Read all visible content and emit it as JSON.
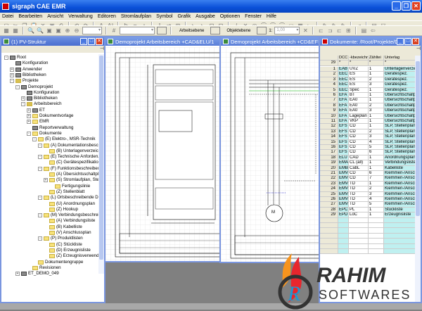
{
  "app": {
    "title": "sigraph CAE EMR"
  },
  "menu": [
    "Datei",
    "Bearbeiten",
    "Ansicht",
    "Verwaltung",
    "Editoren",
    "Stromlaufplan",
    "Symbol",
    "Grafik",
    "Ausgabe",
    "Optionen",
    "Fenster",
    "Hilfe"
  ],
  "toolbar": {
    "arbeitsebene": "Arbeitsebene",
    "objektebene": "Objektebene",
    "scale_prefix": "1:",
    "scale_value": "1,00"
  },
  "tree_panel": {
    "title": "(1) PV-Struktur",
    "nodes": [
      {
        "d": 0,
        "e": "-",
        "i": "t",
        "t": "Root"
      },
      {
        "d": 1,
        "e": "",
        "i": "t",
        "t": "Konfiguration"
      },
      {
        "d": 1,
        "e": "+",
        "i": "t",
        "t": "Anwender"
      },
      {
        "d": 1,
        "e": "+",
        "i": "t",
        "t": "Bibliotheken"
      },
      {
        "d": 1,
        "e": "-",
        "i": "g",
        "t": "Projekte"
      },
      {
        "d": 2,
        "e": "-",
        "i": "t",
        "t": "Demoprojekt"
      },
      {
        "d": 3,
        "e": "",
        "i": "t",
        "t": "Konfiguration"
      },
      {
        "d": 3,
        "e": "+",
        "i": "t",
        "t": "Bibliotheken"
      },
      {
        "d": 3,
        "e": "-",
        "i": "g",
        "t": "Arbeitsbereich"
      },
      {
        "d": 4,
        "e": "+",
        "i": "t",
        "t": "ET"
      },
      {
        "d": 4,
        "e": "+",
        "i": "f",
        "t": "Dokumentvorlage"
      },
      {
        "d": 4,
        "e": "+",
        "i": "f",
        "t": "EMR"
      },
      {
        "d": 4,
        "e": "",
        "i": "t",
        "t": "Reportverwaltung"
      },
      {
        "d": 4,
        "e": "-",
        "i": "f",
        "t": "Dokumente"
      },
      {
        "d": 5,
        "e": "-",
        "i": "f",
        "t": "(E) Elektro-, MSR-Technik"
      },
      {
        "d": 6,
        "e": "-",
        "i": "f",
        "t": "(A) Dokumentationsbeschreibende"
      },
      {
        "d": 7,
        "e": "",
        "i": "f",
        "t": "(B) Unterlagenverzeichnis"
      },
      {
        "d": 6,
        "e": "-",
        "i": "f",
        "t": "(E) Technische Anforderungen und"
      },
      {
        "d": 7,
        "e": "",
        "i": "f",
        "t": "(C) Gerätespezifikation"
      },
      {
        "d": 6,
        "e": "-",
        "i": "f",
        "t": "(F) Funktionsbeschreibende Dokun"
      },
      {
        "d": 7,
        "e": "",
        "i": "f",
        "t": "(A) Übersichtsschaltplan"
      },
      {
        "d": 7,
        "e": "+",
        "i": "f",
        "t": "(S) Stromlaufplan, Stellenplan"
      },
      {
        "d": 8,
        "e": "",
        "i": "f",
        "t": "Fertigungslinie"
      },
      {
        "d": 7,
        "e": "",
        "i": "f",
        "t": "(Z) Stellenblatt"
      },
      {
        "d": 6,
        "e": "-",
        "i": "f",
        "t": "(L) Ortsbeschreibende Dokumente"
      },
      {
        "d": 7,
        "e": "",
        "i": "f",
        "t": "(U) Anordnungsplan"
      },
      {
        "d": 7,
        "e": "",
        "i": "f",
        "t": "(Z) Hookup"
      },
      {
        "d": 6,
        "e": "-",
        "i": "f",
        "t": "(M) Verbindungsbeschreibende Do"
      },
      {
        "d": 7,
        "e": "",
        "i": "f",
        "t": "(A) Verbindungsliste"
      },
      {
        "d": 7,
        "e": "",
        "i": "f",
        "t": "(B) Kabelliste"
      },
      {
        "d": 7,
        "e": "",
        "i": "f",
        "t": "(V) Anschlussplan"
      },
      {
        "d": 6,
        "e": "-",
        "i": "f",
        "t": "(P) Produktlisten"
      },
      {
        "d": 7,
        "e": "",
        "i": "f",
        "t": "(C) Stückliste"
      },
      {
        "d": 7,
        "e": "",
        "i": "f",
        "t": "(D) Erzeugnisliste"
      },
      {
        "d": 7,
        "e": "",
        "i": "f",
        "t": "(Z) Erzeugnisverwendungsplan"
      },
      {
        "d": 5,
        "e": "",
        "i": "f",
        "t": "Dokumentengruppe"
      },
      {
        "d": 4,
        "e": "",
        "i": "f",
        "t": "Revisionen"
      },
      {
        "d": 2,
        "e": "+",
        "i": "t",
        "t": "ET_DEMO_049"
      }
    ]
  },
  "drawing1": {
    "title": "Demoprojekt Arbeitsbereich +CAD&ELU/1"
  },
  "drawing2": {
    "title": "Demoprojekt Arbeitsbereich +CD&EFS/2"
  },
  "doc_panel": {
    "title": "Dokumente: /Root/Projekte/De...",
    "headers": [
      "",
      "DCC",
      "-kbezeichn",
      "Zähltei",
      "Unterlag"
    ],
    "count": "29",
    "filter": [
      "",
      "*",
      "*",
      "*",
      "*"
    ],
    "rows": [
      [
        "1",
        "EAB",
        "UVZ",
        "1",
        "Unterlagenverzeic"
      ],
      [
        "2",
        "EEC",
        "ES",
        "1",
        "Gerätespez."
      ],
      [
        "3",
        "EEC",
        "ES",
        "2",
        "Gerätespez."
      ],
      [
        "4",
        "EEC",
        "ES",
        "3",
        "Gerätespez."
      ],
      [
        "5",
        "EEC",
        "Spec",
        "1",
        "Gerätespez."
      ],
      [
        "6",
        "EFA",
        "BT",
        "1",
        "Übersichtschaltp"
      ],
      [
        "7",
        "EFA",
        "EA0",
        "1",
        "Übersichtschaltp"
      ],
      [
        "8",
        "EFA",
        "EA0",
        "2",
        "Übersichtschaltp"
      ],
      [
        "9",
        "EFA",
        "EA0",
        "3",
        "Übersichtschaltp"
      ],
      [
        "10",
        "EFA",
        "Lageplan",
        "1",
        "Übersichtschaltp"
      ],
      [
        "11",
        "EFA",
        "VKP",
        "1",
        "Übersichtschaltp"
      ],
      [
        "12",
        "EFS",
        "CD",
        "1",
        "SLP, Stellenplan"
      ],
      [
        "13",
        "EFS",
        "CD",
        "2",
        "SLP, Stellenplan"
      ],
      [
        "14",
        "EFS",
        "CD",
        "3",
        "SLP, Stellenplan"
      ],
      [
        "15",
        "EFS",
        "CD",
        "4",
        "SLP, Stellenplan"
      ],
      [
        "16",
        "EFS",
        "CD",
        "5",
        "SLP, Stellenplan"
      ],
      [
        "17",
        "EFS",
        "CD",
        "6",
        "SLP, Stellenplan"
      ],
      [
        "18",
        "ELU",
        "CAD",
        "1",
        "Anordnungsplan"
      ],
      [
        "19",
        "EMA",
        "CL (all)",
        "1",
        "Verbindungsliste/"
      ],
      [
        "20",
        "EMB",
        "CabL",
        "1",
        "Kabelliste"
      ],
      [
        "21",
        "EMV",
        "CD",
        "6",
        "Klemmen-/Anschl"
      ],
      [
        "22",
        "EMV",
        "CD",
        "7",
        "Klemmen-/Anschl"
      ],
      [
        "23",
        "EMV",
        "TD",
        "1",
        "Klemmen-/Anschl"
      ],
      [
        "24",
        "EMV",
        "TD",
        "2",
        "Klemmen-/Anschl"
      ],
      [
        "25",
        "EMV",
        "TD",
        "3",
        "Klemmen-/Anschl"
      ],
      [
        "26",
        "EMV",
        "TD",
        "4",
        "Klemmen-/Anschl"
      ],
      [
        "27",
        "EMV",
        "TD",
        "5",
        "Klemmen-/Anschl"
      ],
      [
        "28",
        "EPC",
        "PL",
        "1",
        "Stückliste"
      ],
      [
        "29",
        "EPD",
        "LoC",
        "1",
        "Erzeugnisliste"
      ]
    ]
  },
  "watermark": {
    "line1": "RAHIM",
    "line2": "SOFTWARES",
    "logo_letter": "R"
  }
}
